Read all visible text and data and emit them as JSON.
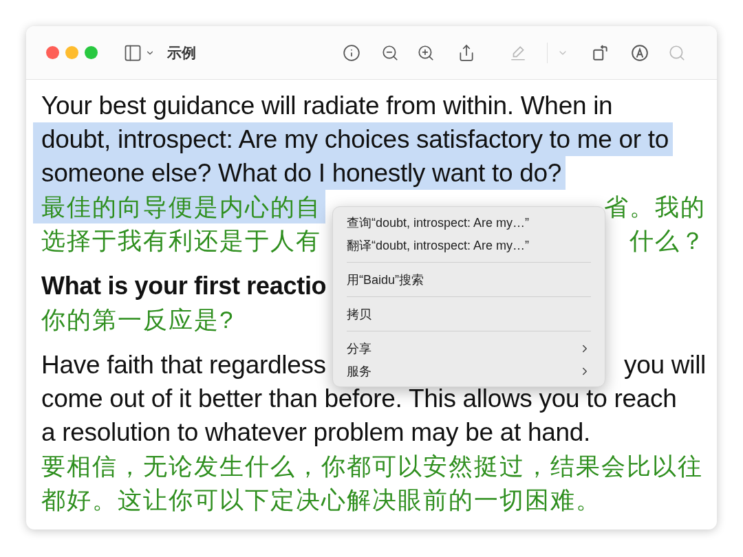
{
  "window": {
    "title": "示例"
  },
  "tools": [
    {
      "kind": "info",
      "disabled": false
    },
    {
      "kind": "zoom-out",
      "disabled": false
    },
    {
      "kind": "zoom-in",
      "disabled": false
    },
    {
      "kind": "share",
      "disabled": false
    },
    {
      "kind": "highlight",
      "disabled": true
    },
    {
      "kind": "highlight-menu",
      "disabled": true
    },
    {
      "kind": "rotate",
      "disabled": false
    },
    {
      "kind": "markup",
      "disabled": false
    },
    {
      "kind": "search",
      "disabled": true
    }
  ],
  "paragraphs": [
    {
      "lines": [
        {
          "kind": "english",
          "segments": [
            {
              "text": "Your best guidance will radiate from within. When in",
              "selected": false
            }
          ]
        },
        {
          "kind": "english",
          "segments": [
            {
              "text": "doubt, introspect: Are my choices satisfactory to me or to",
              "selected": true
            }
          ]
        },
        {
          "kind": "english",
          "segments": [
            {
              "text": "someone else? What do I honestly want to do?",
              "selected": true
            }
          ]
        },
        {
          "kind": "chinese",
          "segments": [
            {
              "text": "最佳的向导便是内心的自",
              "selected": true
            },
            {
              "text": "省。我的",
              "selected": false
            }
          ]
        },
        {
          "kind": "chinese",
          "segments": [
            {
              "text": "选择于我有利还是于人有",
              "selected": false
            },
            {
              "text": "什么？",
              "selected": false
            }
          ]
        }
      ]
    },
    {
      "lines": [
        {
          "kind": "heading",
          "segments": [
            {
              "text": "What is your first reactio",
              "selected": false
            }
          ]
        },
        {
          "kind": "chinese",
          "segments": [
            {
              "text": "你的第一反应是?",
              "selected": false
            }
          ]
        }
      ]
    },
    {
      "lines": [
        {
          "kind": "english",
          "segments": [
            {
              "text": "Have faith that regardless",
              "selected": false
            },
            {
              "text": "you will",
              "selected": false
            }
          ]
        },
        {
          "kind": "english",
          "segments": [
            {
              "text": "come out of it better than before. This allows you to reach",
              "selected": false
            }
          ]
        },
        {
          "kind": "english",
          "segments": [
            {
              "text": "a resolution to whatever problem may be at hand.",
              "selected": false
            }
          ]
        },
        {
          "kind": "chinese",
          "segments": [
            {
              "text": "要相信，无论发生什么，你都可以安然挺过，结果会比以往",
              "selected": false
            }
          ]
        },
        {
          "kind": "chinese",
          "segments": [
            {
              "text": "都好。这让你可以下定决心解决眼前的一切困难。",
              "selected": false
            }
          ]
        }
      ]
    }
  ],
  "context_menu": {
    "groups": [
      [
        {
          "label": "查询“doubt, introspect: Are my…”",
          "submenu": false
        },
        {
          "label": "翻译“doubt, introspect: Are my…”",
          "submenu": false
        }
      ],
      [
        {
          "label": "用“Baidu”搜索",
          "submenu": false
        }
      ],
      [
        {
          "label": "拷贝",
          "submenu": false
        }
      ],
      [
        {
          "label": "分享",
          "submenu": true
        },
        {
          "label": "服务",
          "submenu": true
        }
      ]
    ]
  }
}
